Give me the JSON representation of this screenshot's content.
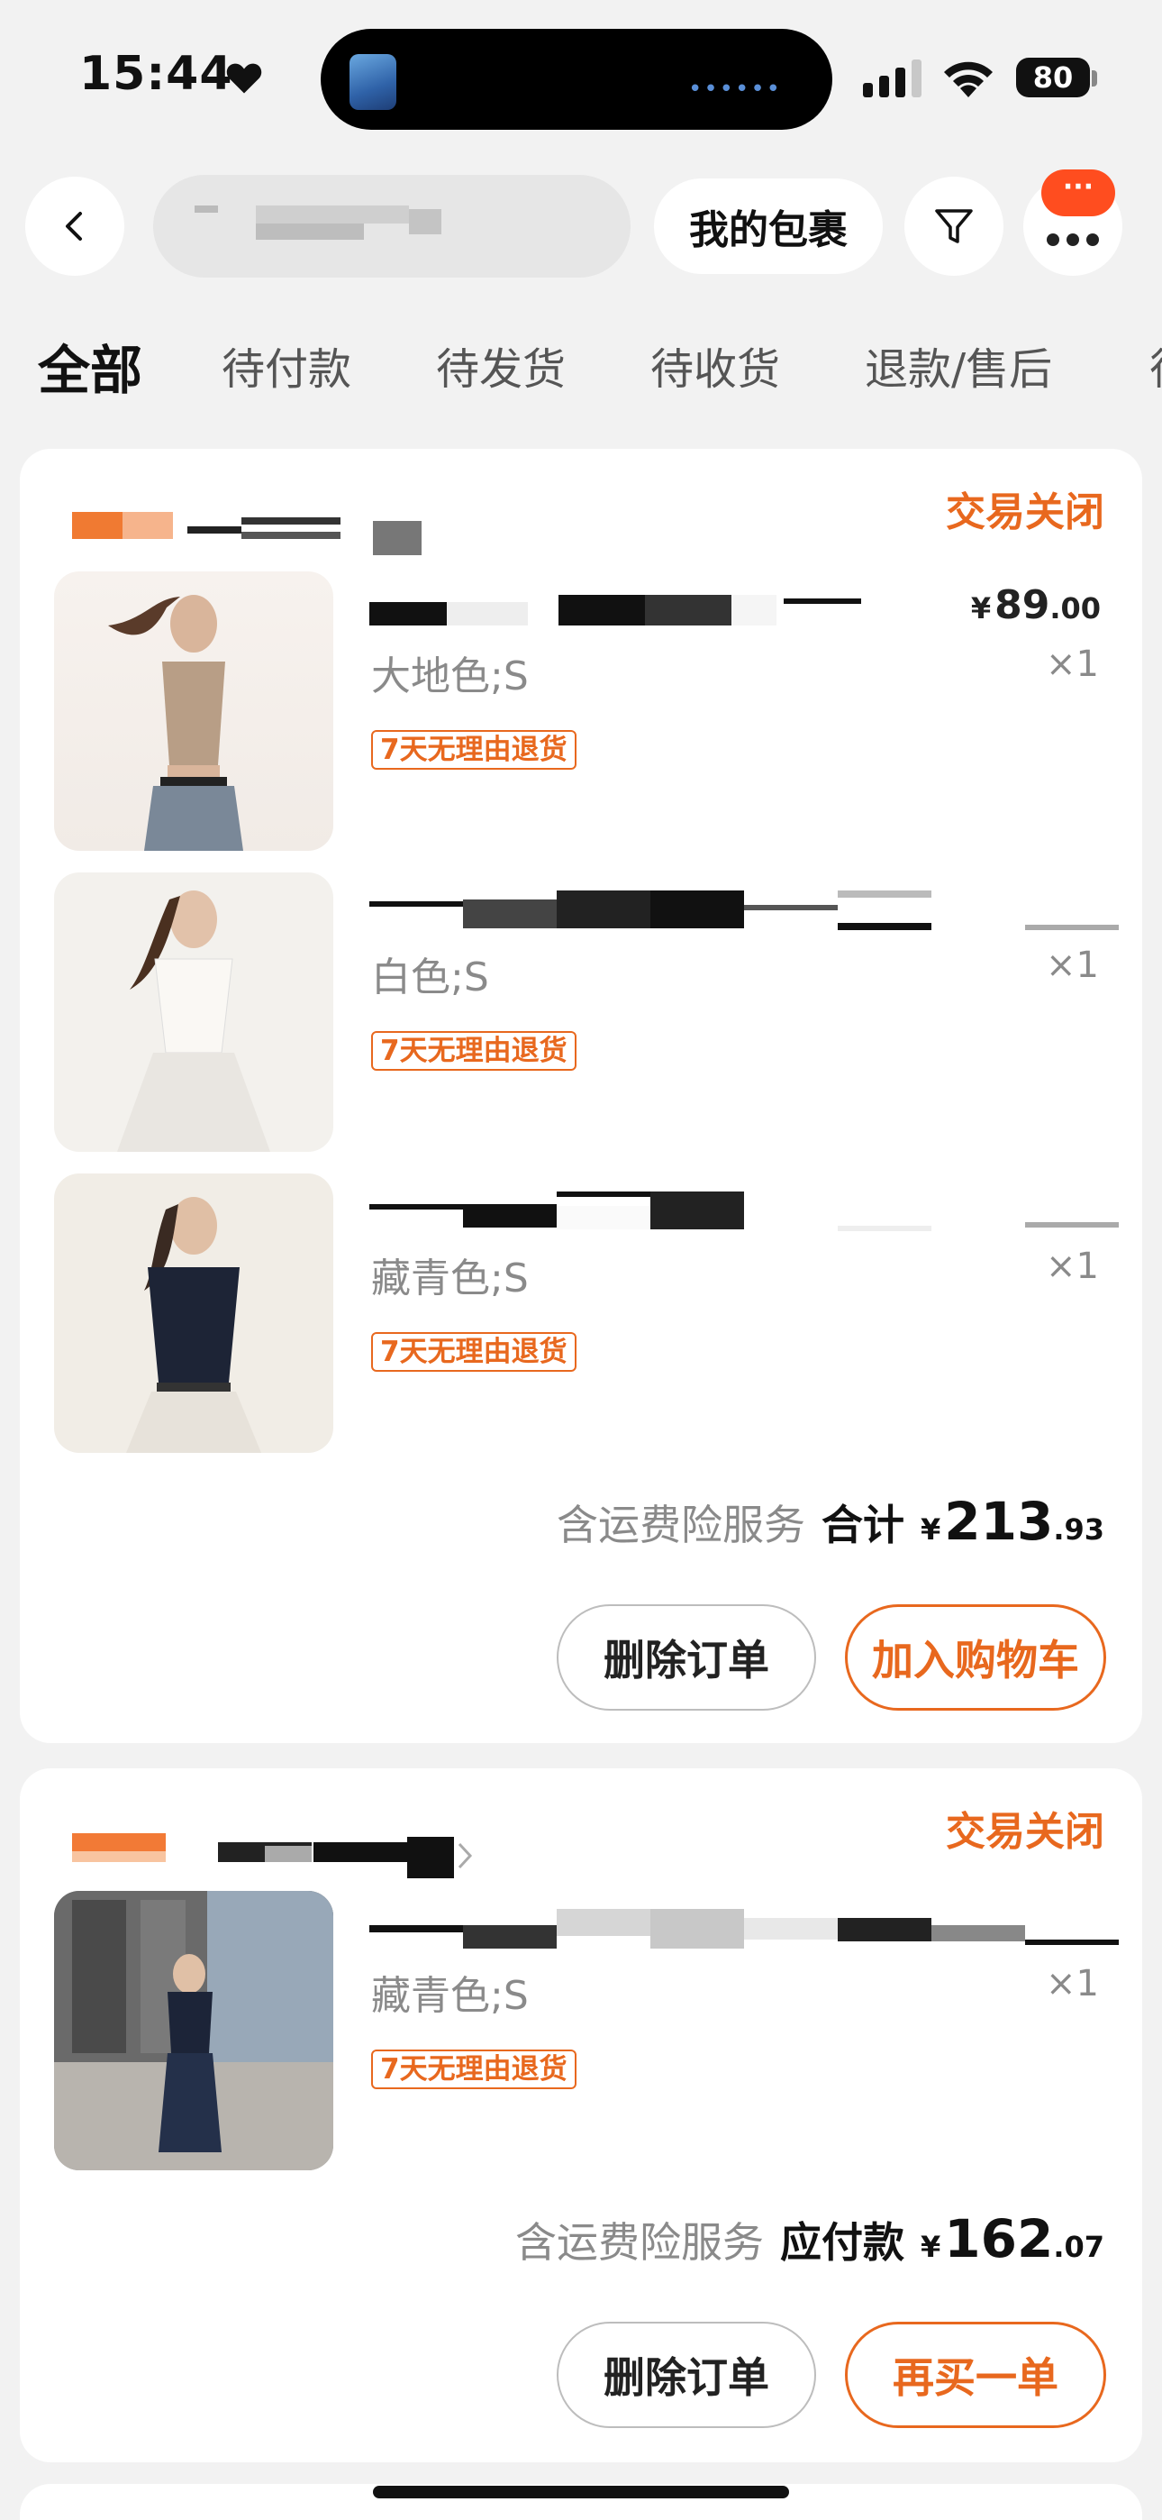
{
  "status_bar": {
    "time": "15:44",
    "battery": "80",
    "island_dots": "••••••"
  },
  "nav": {
    "packages_label": "我的包裹",
    "bubble_text": "···"
  },
  "tabs": [
    "全部",
    "待付款",
    "待发货",
    "待收货",
    "退款/售后",
    "待"
  ],
  "orders": [
    {
      "status": "交易关闭",
      "items": [
        {
          "variant": "大地色;S",
          "qty": "×1",
          "badge": "7天无理由退货",
          "price_int": "89",
          "price_dec": ".00"
        },
        {
          "variant": "白色;S",
          "qty": "×1",
          "badge": "7天无理由退货"
        },
        {
          "variant": "藏青色;S",
          "qty": "×1",
          "badge": "7天无理由退货"
        }
      ],
      "insurance": "含运费险服务",
      "total_label": "合计",
      "total_int": "213",
      "total_dec": ".93",
      "btn_delete": "删除订单",
      "btn_action": "加入购物车"
    },
    {
      "status": "交易关闭",
      "items": [
        {
          "variant": "藏青色;S",
          "qty": "×1",
          "badge": "7天无理由退货"
        }
      ],
      "insurance": "含运费险服务",
      "total_label": "应付款",
      "total_int": "162",
      "total_dec": ".07",
      "btn_delete": "删除订单",
      "btn_action": "再买一单"
    }
  ],
  "currency": "¥",
  "colors": {
    "accent": "#e8681e",
    "bubble": "#ff4d1f",
    "background": "#f2f2f2"
  }
}
